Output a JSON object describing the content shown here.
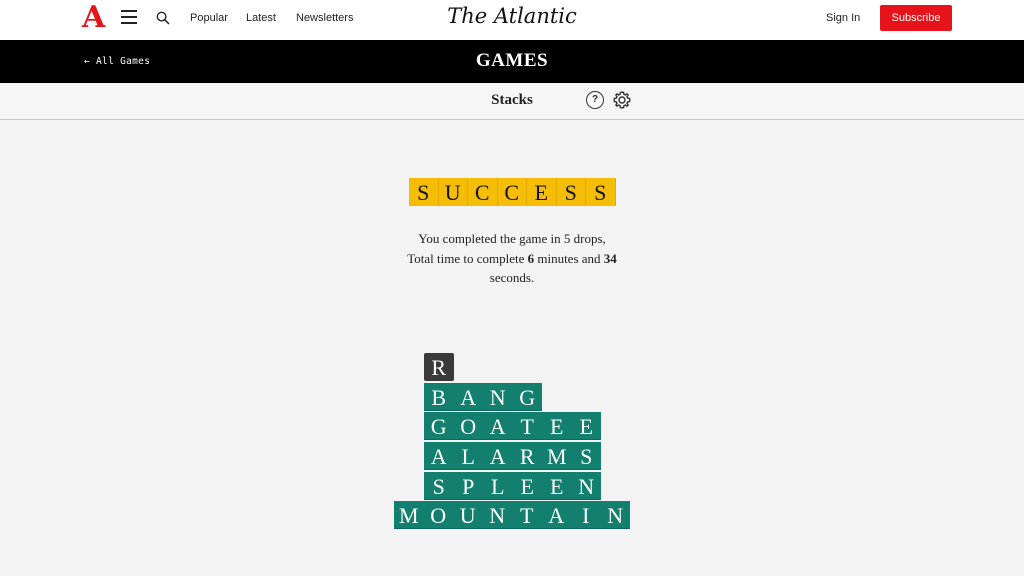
{
  "nav": {
    "logo": "A",
    "links": [
      "Popular",
      "Latest",
      "Newsletters"
    ],
    "brand": "The Atlantic",
    "signin": "Sign In",
    "subscribe": "Subscribe"
  },
  "games_bar": {
    "back_link": "← All Games",
    "title": "GAMES"
  },
  "game": {
    "name": "Stacks"
  },
  "result": {
    "banner_letters": [
      "S",
      "U",
      "C",
      "C",
      "E",
      "S",
      "S"
    ],
    "line1": "You completed the game in 5 drops,",
    "line2_prefix": "Total time to complete ",
    "minutes": "6",
    "line2_mid": " minutes and ",
    "seconds": "34",
    "line3": "seconds."
  },
  "stack": {
    "current_tile": "R",
    "rows": [
      [
        "B",
        "A",
        "N",
        "G"
      ],
      [
        "G",
        "O",
        "A",
        "T",
        "E",
        "E"
      ],
      [
        "A",
        "L",
        "A",
        "R",
        "M",
        "S"
      ],
      [
        "S",
        "P",
        "L",
        "E",
        "E",
        "N"
      ],
      [
        "M",
        "O",
        "U",
        "N",
        "T",
        "A",
        "I",
        "N"
      ]
    ]
  },
  "colors": {
    "accent_red": "#e7131a",
    "success_yellow": "#f6bd07",
    "tile_green": "#13806f",
    "tile_dark": "#3a3a3a"
  }
}
